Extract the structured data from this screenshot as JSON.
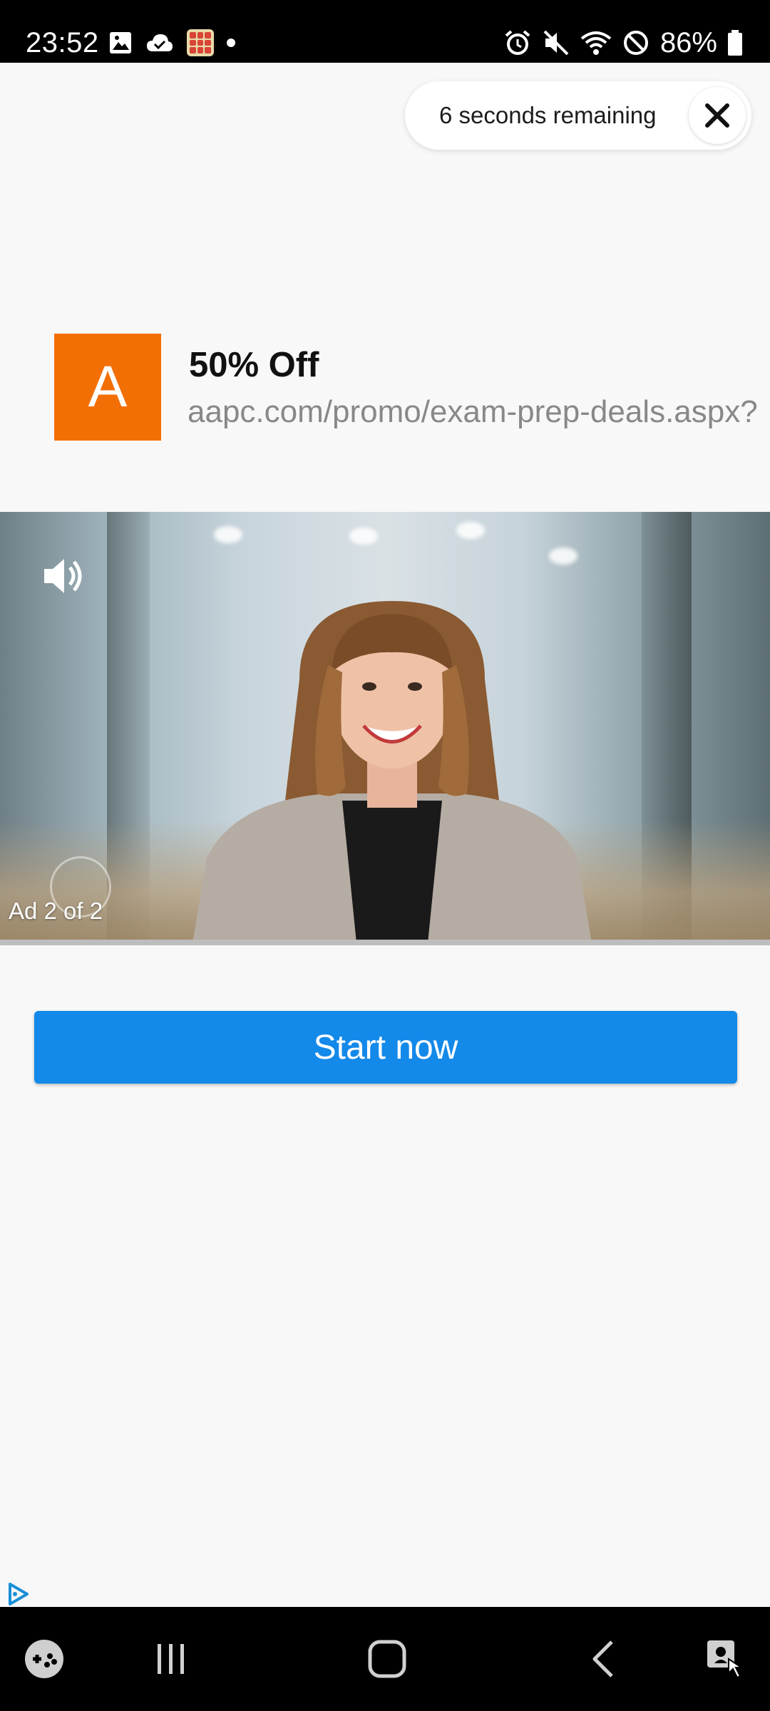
{
  "status_bar": {
    "time": "23:52",
    "battery": "86%",
    "left_icons": [
      "gallery-icon",
      "cloud-check-icon",
      "game-app-icon",
      "notification-dot"
    ],
    "right_icons": [
      "alarm-icon",
      "mute-icon",
      "wifi-icon",
      "do-not-disturb-icon",
      "battery-icon"
    ]
  },
  "ad": {
    "countdown_text": "6 seconds remaining",
    "close_icon": "close-icon",
    "advertiser_logo_letter": "A",
    "advertiser_logo_color": "#f26f06",
    "title": "50% Off",
    "url": "aapc.com/promo/exam-prep-deals.aspx?",
    "ad_counter": "Ad 2 of 2",
    "sound_icon": "speaker-icon",
    "cta_label": "Start now",
    "cta_color": "#1389e9",
    "video_progress": 1.0
  },
  "nav_bar": {
    "items": [
      "game-launcher-icon",
      "recent-apps-icon",
      "home-icon",
      "back-icon",
      "accessibility-icon"
    ]
  }
}
